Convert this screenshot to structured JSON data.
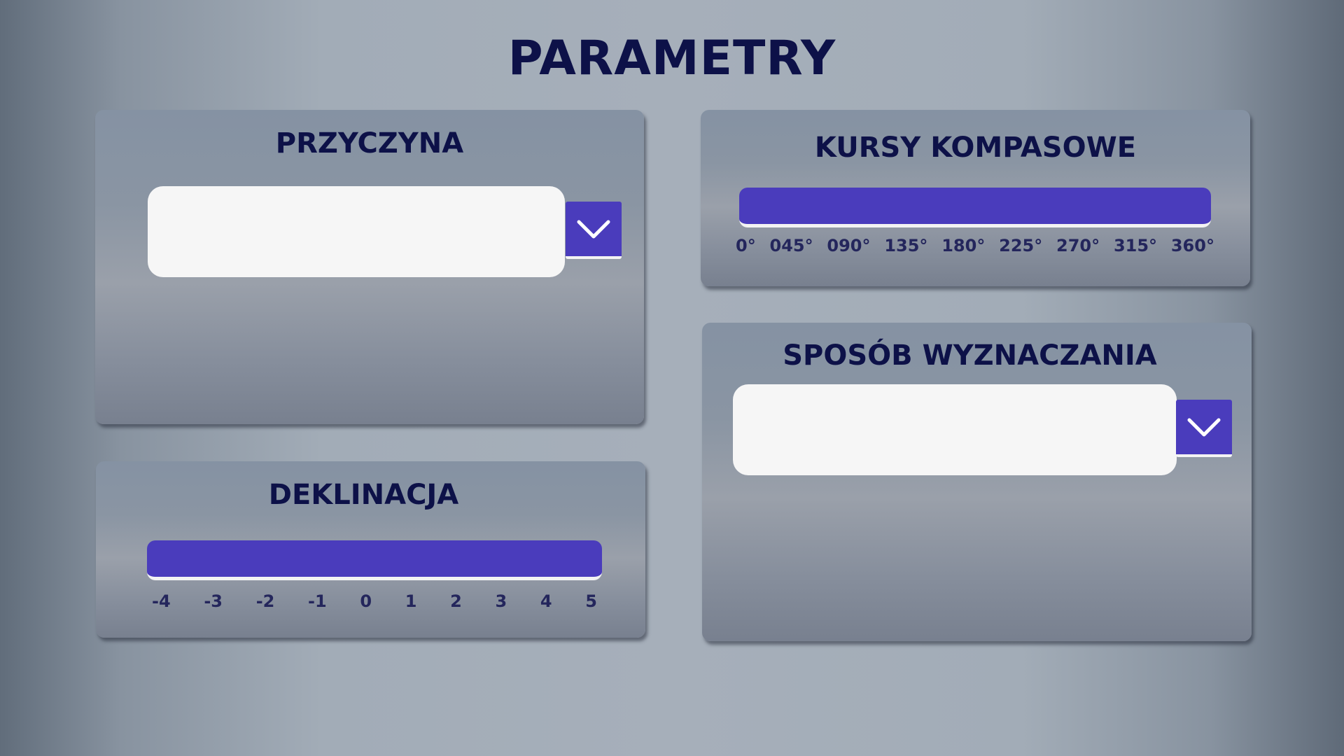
{
  "page": {
    "title": "PARAMETRY"
  },
  "przyczyna": {
    "title": "PRZYCZYNA",
    "value": "",
    "dropdown_icon": "chevron-down-icon"
  },
  "kursy": {
    "title": "KURSY KOMPASOWE",
    "ticks": [
      "0°",
      "045°",
      "090°",
      "135°",
      "180°",
      "225°",
      "270°",
      "315°",
      "360°"
    ]
  },
  "deklinacja": {
    "title": "DEKLINACJA",
    "ticks": [
      "-4",
      "-3",
      "-2",
      "-1",
      "0",
      "1",
      "2",
      "3",
      "4",
      "5"
    ]
  },
  "sposob": {
    "title": "SPOSÓB WYZNACZANIA",
    "value": "",
    "dropdown_icon": "chevron-down-icon"
  },
  "colors": {
    "accent": "#4a3cbc",
    "title_text": "#0d1148",
    "tick_text": "#24265c",
    "input_bg": "#f6f6f6"
  }
}
